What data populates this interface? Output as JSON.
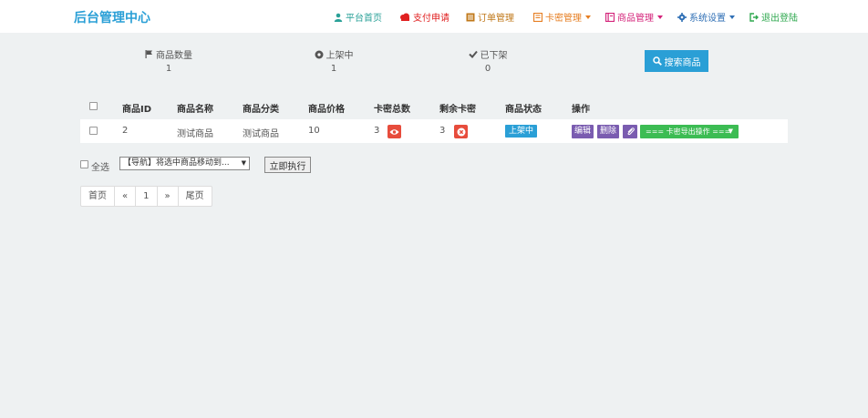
{
  "header": {
    "brand": "后台管理中心",
    "nav": [
      {
        "label": "平台首页",
        "icon": "user-icon",
        "color": "#2aa198",
        "dropdown": false
      },
      {
        "label": "支付申请",
        "icon": "cloud-icon",
        "color": "#e02020",
        "dropdown": false
      },
      {
        "label": "订单管理",
        "icon": "list-box-icon",
        "color": "#c0781a",
        "dropdown": false
      },
      {
        "label": "卡密管理",
        "icon": "card-icon",
        "color": "#e67e22",
        "dropdown": true
      },
      {
        "label": "商品管理",
        "icon": "book-icon",
        "color": "#d4237a",
        "dropdown": true
      },
      {
        "label": "系统设置",
        "icon": "gear-icon",
        "color": "#2f6fb5",
        "dropdown": true
      },
      {
        "label": "退出登陆",
        "icon": "logout-icon",
        "color": "#2fa84f",
        "dropdown": false
      }
    ]
  },
  "stats": {
    "total": {
      "label": "商品数量",
      "value": "1",
      "icon": "flag-icon"
    },
    "on_shelf": {
      "label": "上架中",
      "value": "1",
      "icon": "play-circle-icon"
    },
    "off_shelf": {
      "label": "已下架",
      "value": "0",
      "icon": "check-icon"
    },
    "search_button": "搜索商品"
  },
  "table": {
    "headers": [
      "商品ID",
      "商品名称",
      "商品分类",
      "商品价格",
      "卡密总数",
      "剩余卡密",
      "商品状态",
      "操作"
    ],
    "rows": [
      {
        "id": "2",
        "name": "测试商品",
        "category": "测试商品",
        "price": "10",
        "card_total": "3",
        "card_left": "3",
        "status": "上架中",
        "ops": {
          "edit": "编辑",
          "delete": "删除",
          "export": "=== 卡密导出操作 ==="
        }
      }
    ]
  },
  "batch": {
    "select_all": "全选",
    "move_select": "【导航】将选中商品移动到...",
    "execute": "立即执行"
  },
  "pagination": [
    "首页",
    "«",
    "1",
    "»",
    "尾页"
  ],
  "colors": {
    "accent": "#2a9fd6",
    "danger": "#e74c3c",
    "purple": "#7a5cb0",
    "green": "#3cbc53"
  }
}
